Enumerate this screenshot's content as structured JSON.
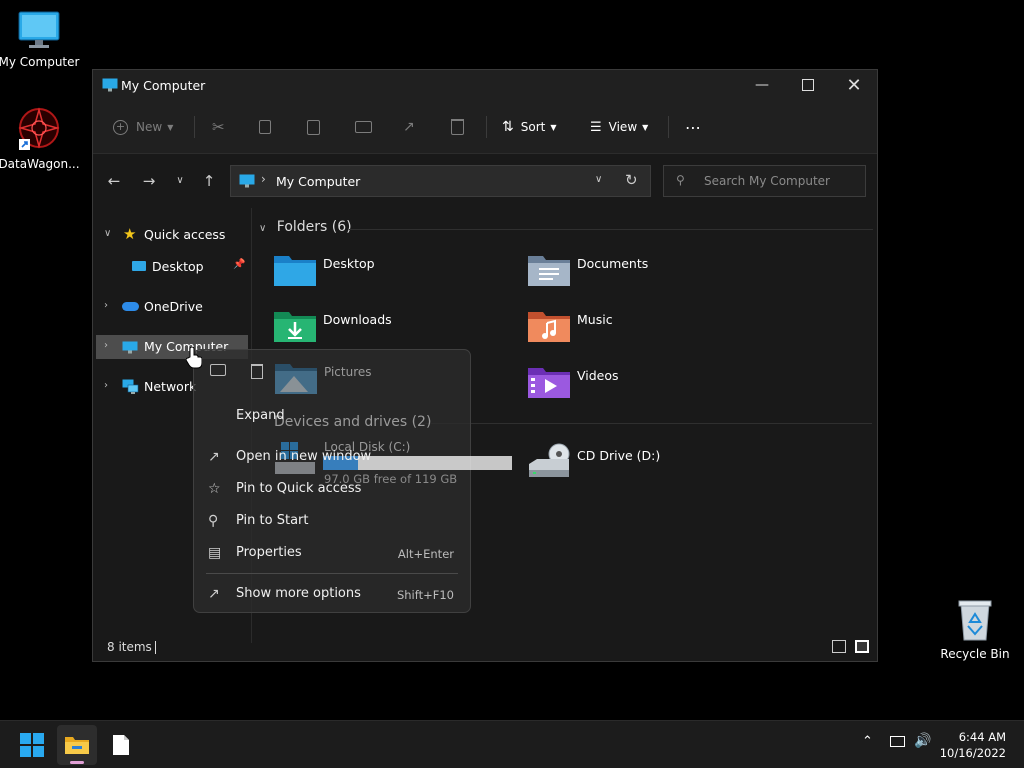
{
  "desktop": {
    "icons": [
      {
        "label": "My Computer"
      },
      {
        "label": "DataWagon..."
      },
      {
        "label": "Recycle Bin"
      }
    ]
  },
  "window": {
    "title": "My Computer",
    "commands": {
      "new_label": "New",
      "sort_label": "Sort",
      "view_label": "View"
    },
    "address": {
      "path": "My Computer",
      "search_placeholder": "Search My Computer"
    },
    "nav": [
      {
        "label": "Quick access"
      },
      {
        "label": "Desktop"
      },
      {
        "label": "OneDrive"
      },
      {
        "label": "My Computer"
      },
      {
        "label": "Network"
      }
    ],
    "folders_header": "Folders (6)",
    "folders": [
      {
        "name": "Desktop"
      },
      {
        "name": "Documents"
      },
      {
        "name": "Downloads"
      },
      {
        "name": "Music"
      },
      {
        "name": "Pictures"
      },
      {
        "name": "Videos"
      }
    ],
    "drives_header": "Devices and drives (2)",
    "drives": [
      {
        "name": "Local Disk (C:)",
        "free_text": "97.0 GB free of 119 GB",
        "used_fraction": 0.185
      },
      {
        "name": "CD Drive (D:)"
      }
    ],
    "status": {
      "items_text": "8 items"
    }
  },
  "context_menu": {
    "items": [
      {
        "label": "Expand",
        "shortcut": ""
      },
      {
        "label": "Open in new window",
        "shortcut": ""
      },
      {
        "label": "Pin to Quick access",
        "shortcut": ""
      },
      {
        "label": "Pin to Start",
        "shortcut": ""
      },
      {
        "label": "Properties",
        "shortcut": "Alt+Enter"
      },
      {
        "label": "Show more options",
        "shortcut": "Shift+F10"
      }
    ]
  },
  "taskbar": {
    "time": "6:44 AM",
    "date": "10/16/2022"
  },
  "colors": {
    "accent": "#0078d4",
    "selection": "#4d4d4d"
  }
}
